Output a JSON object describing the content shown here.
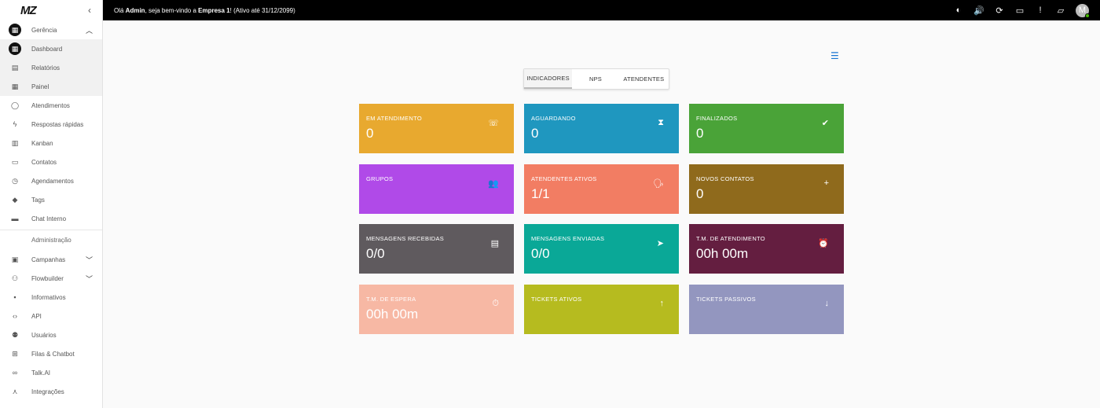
{
  "brand": {
    "logo": "MZ",
    "collapse_icon": "chevron-left-icon"
  },
  "sidebar": {
    "items": [
      {
        "label": "Gerência",
        "icon": "dashboard-icon",
        "filled": true,
        "chevron": "up"
      },
      {
        "label": "Dashboard",
        "icon": "grid-icon",
        "filled": true,
        "sub": true
      },
      {
        "label": "Relatórios",
        "icon": "document-icon",
        "sub": true
      },
      {
        "label": "Painel",
        "icon": "table-icon",
        "sub": true
      },
      {
        "label": "Atendimentos",
        "icon": "whatsapp-icon"
      },
      {
        "label": "Respostas rápidas",
        "icon": "bolt-icon"
      },
      {
        "label": "Kanban",
        "icon": "kanban-icon"
      },
      {
        "label": "Contatos",
        "icon": "contact-card-icon"
      },
      {
        "label": "Agendamentos",
        "icon": "clock-icon"
      },
      {
        "label": "Tags",
        "icon": "tag-icon"
      },
      {
        "label": "Chat Interno",
        "icon": "chat-icon"
      }
    ],
    "section": "Administração",
    "admin_items": [
      {
        "label": "Campanhas",
        "icon": "calendar-check-icon",
        "chevron": "down"
      },
      {
        "label": "Flowbuilder",
        "icon": "flow-icon",
        "chevron": "down"
      },
      {
        "label": "Informativos",
        "icon": "announcement-icon"
      },
      {
        "label": "API",
        "icon": "code-icon"
      },
      {
        "label": "Usuários",
        "icon": "users-icon"
      },
      {
        "label": "Filas & Chatbot",
        "icon": "queue-icon"
      },
      {
        "label": "Talk.AI",
        "icon": "infinity-icon"
      },
      {
        "label": "Integrações",
        "icon": "hub-icon"
      }
    ]
  },
  "topbar": {
    "greeting_prefix": "Olá ",
    "user": "Admin",
    "greeting_middle": ", seja bem-vindo a ",
    "company": "Empresa 1",
    "greeting_suffix": "! (Ativo até 31/12/2099)",
    "icons": [
      "brightness-icon",
      "volume-icon",
      "refresh-icon",
      "message-icon",
      "alert-icon",
      "forum-icon"
    ],
    "avatar_letter": "M"
  },
  "tabs": [
    "INDICADORES",
    "NPS",
    "ATENDENTES"
  ],
  "cards": [
    {
      "label": "EM ATENDIMENTO",
      "value": "0",
      "icon": "phone-icon",
      "glyph": "☏",
      "color": "#e8a92f"
    },
    {
      "label": "AGUARDANDO",
      "value": "0",
      "icon": "hourglass-icon",
      "glyph": "⧗",
      "color": "#1f97bf"
    },
    {
      "label": "FINALIZADOS",
      "value": "0",
      "icon": "check-circle-icon",
      "glyph": "✔",
      "color": "#4aa338"
    },
    {
      "label": "GRUPOS",
      "value": "",
      "icon": "groups-icon",
      "glyph": "👥",
      "color": "#b04ae8"
    },
    {
      "label": "ATENDENTES ATIVOS",
      "value": "1/1",
      "icon": "record-voice-icon",
      "glyph": "🗣",
      "color": "#f27d63"
    },
    {
      "label": "NOVOS CONTATOS",
      "value": "0",
      "icon": "group-add-icon",
      "glyph": "+",
      "color": "#8f6a1c"
    },
    {
      "label": "MENSAGENS RECEBIDAS",
      "value": "0/0",
      "icon": "chat-bubble-icon",
      "glyph": "▤",
      "color": "#5f5a5e"
    },
    {
      "label": "MENSAGENS ENVIADAS",
      "value": "0/0",
      "icon": "send-icon",
      "glyph": "➤",
      "color": "#0aa897"
    },
    {
      "label": "T.M. DE ATENDIMENTO",
      "value": "00h 00m",
      "icon": "alarm-icon",
      "glyph": "⏰",
      "color": "#641e40"
    },
    {
      "label": "T.M. DE ESPERA",
      "value": "00h 00m",
      "icon": "timer-icon",
      "glyph": "⏱",
      "color": "#f7b8a4"
    },
    {
      "label": "TICKETS ATIVOS",
      "value": "",
      "icon": "arrow-up-icon",
      "glyph": "↑",
      "color": "#b6bb1f"
    },
    {
      "label": "TICKETS PASSIVOS",
      "value": "",
      "icon": "arrow-down-icon",
      "glyph": "↓",
      "color": "#9396bf"
    }
  ]
}
